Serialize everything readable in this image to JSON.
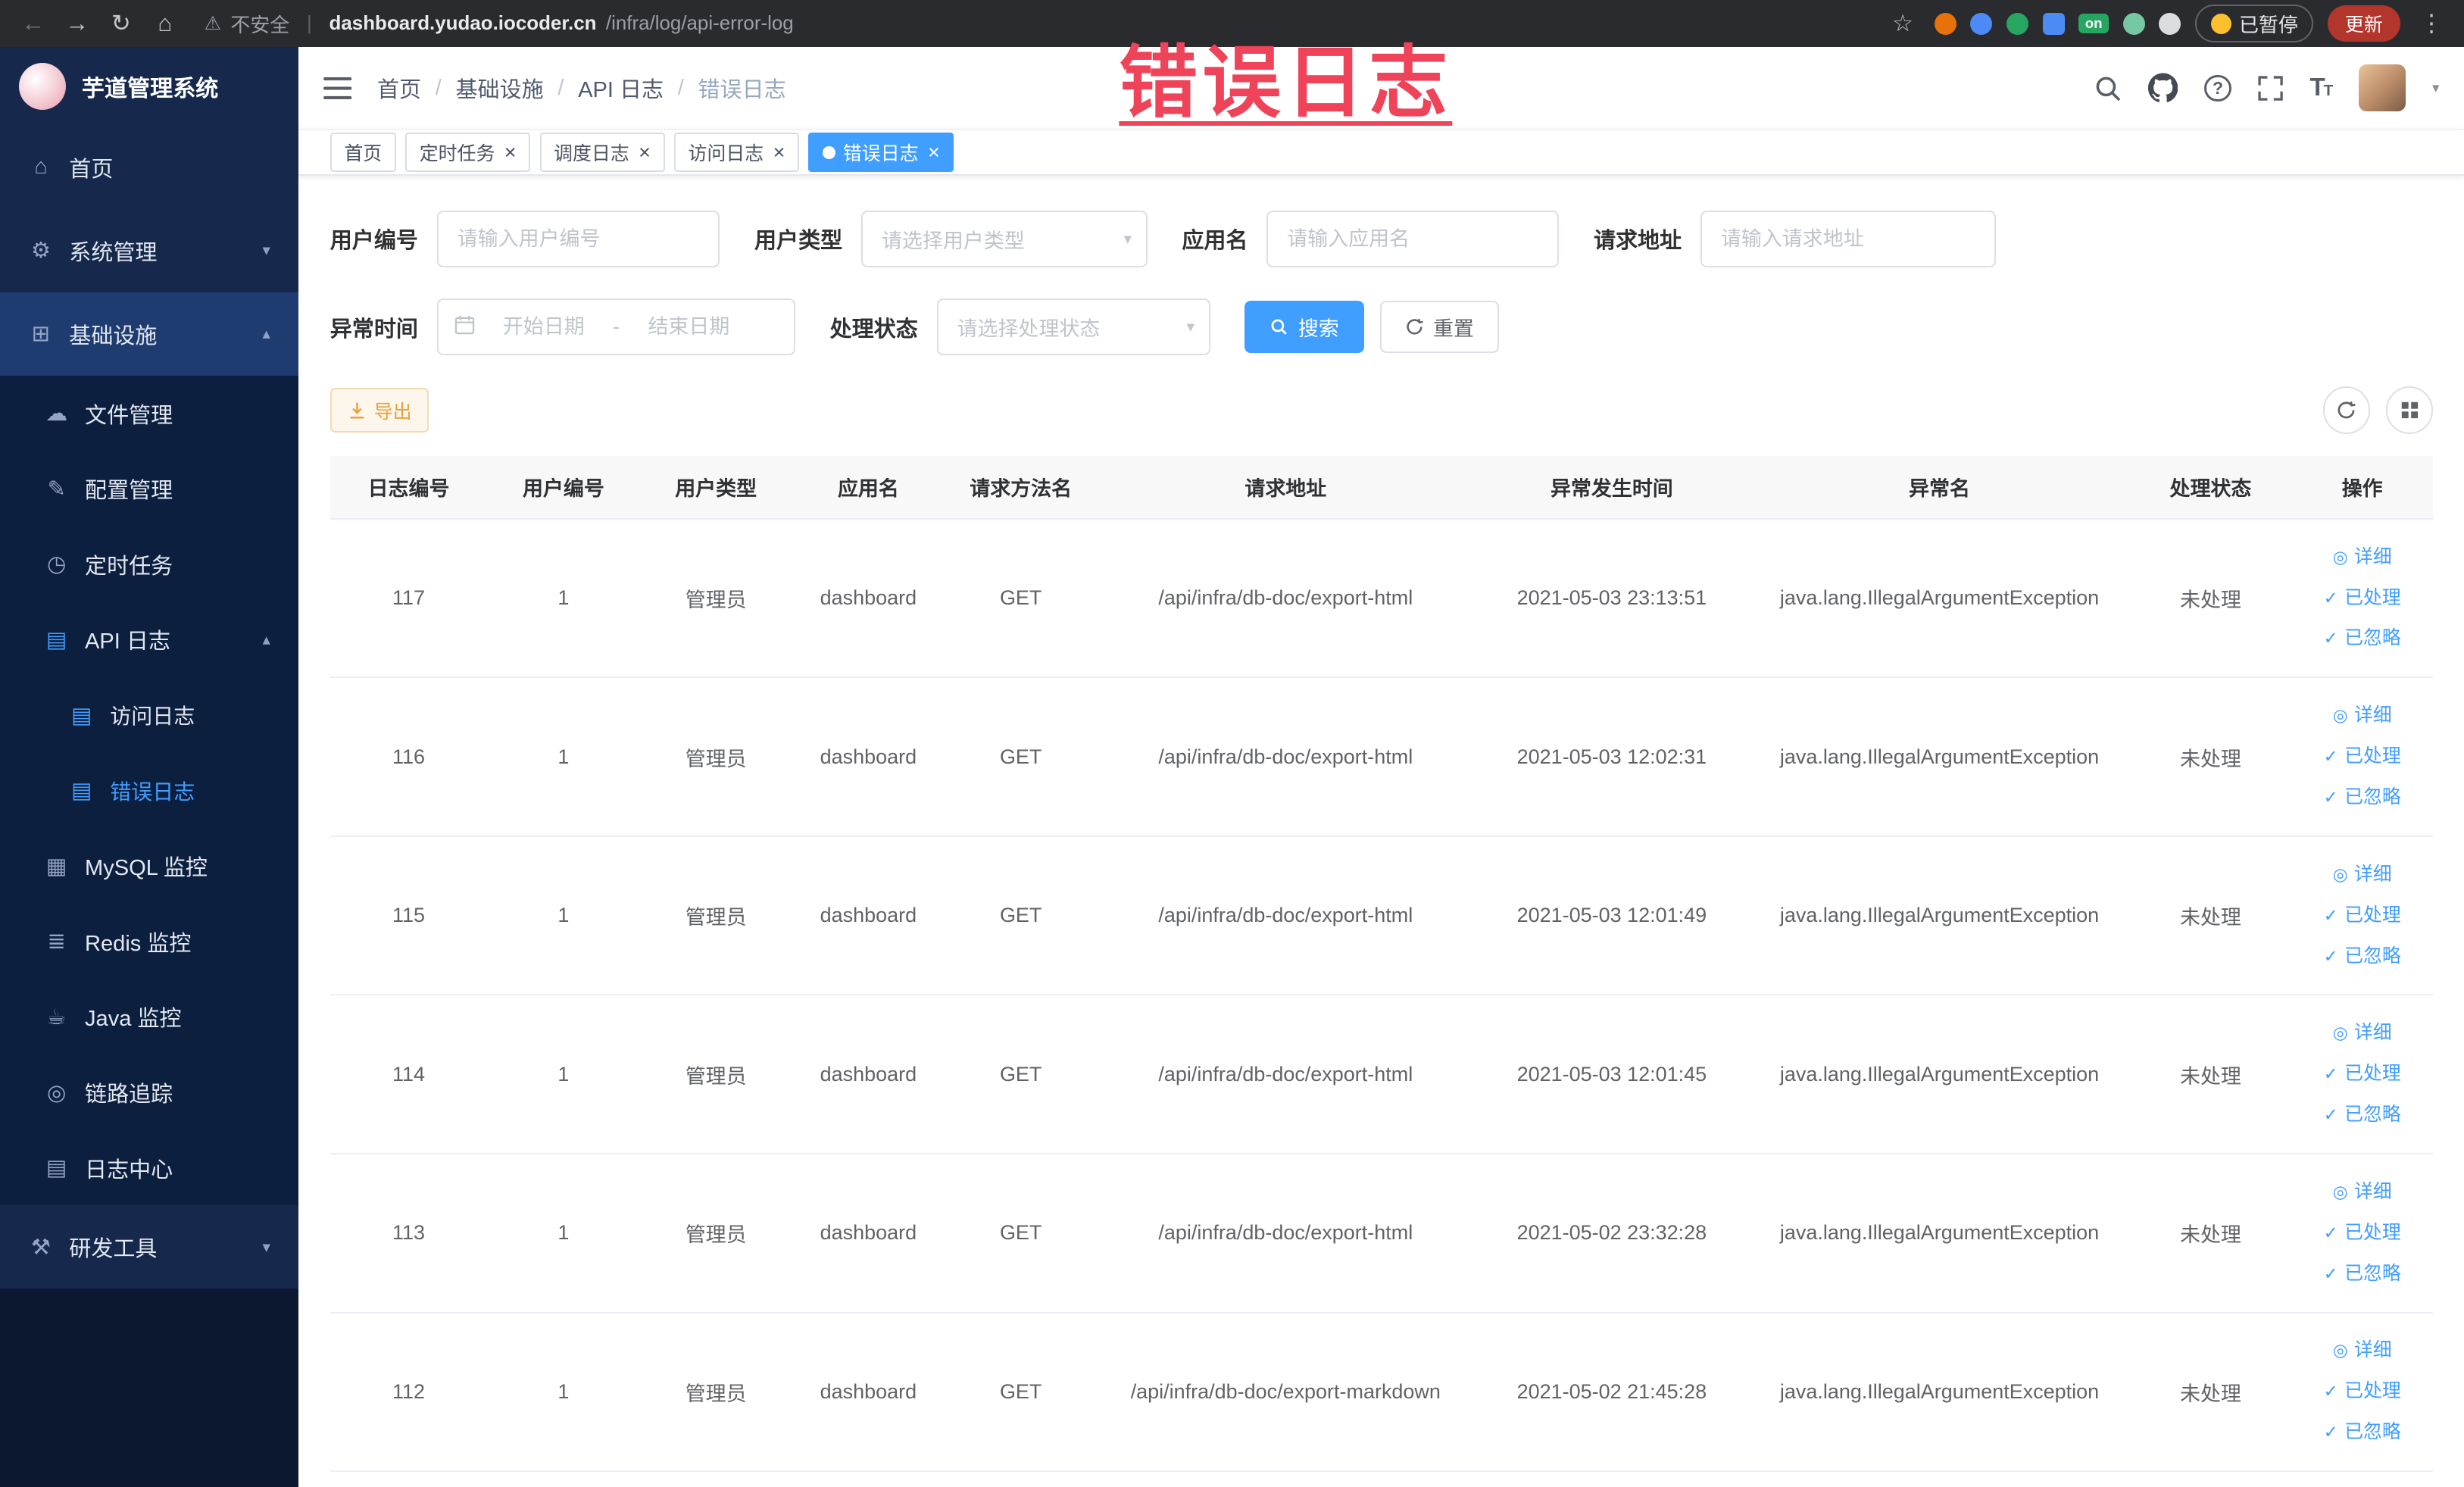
{
  "colors": {
    "accent": "#409eff",
    "warning": "#e6a23c",
    "annotation_red": "#ee4358",
    "sidebar_bg": "#16294c",
    "sidebar_submenu_bg": "#0d1f3e",
    "tab_active_bg": "#409eff"
  },
  "browser": {
    "security_label": "不安全",
    "url_host": "dashboard.yudao.iocoder.cn",
    "url_path": "/infra/log/api-error-log",
    "on_badge": "on",
    "paused_badge": "已暂停",
    "update_button": "更新"
  },
  "annotation": {
    "text": "错误日志"
  },
  "icons": {
    "back": "←",
    "forward": "→",
    "reload": "↻",
    "home_browser": "⌂",
    "warning": "⚠",
    "star": "☆",
    "menu_dots": "⋮",
    "url_separator": "|",
    "home": "⌂",
    "system": "⚙",
    "infra": "⊞",
    "file": "☁",
    "config": "✎",
    "job": "◷",
    "api_log": "▤",
    "access_log": "▤",
    "error_log": "▤",
    "mysql": "▦",
    "redis": "≣",
    "java": "☕",
    "trace": "◎",
    "log_center": "▤",
    "dev_tools": "⚒",
    "chevron_down": "▾",
    "chevron_up": "▴",
    "caret_down": "▾",
    "eye": "◎",
    "check": "✓",
    "close": "×"
  },
  "sidebar": {
    "logo_title": "芋道管理系统",
    "home": "首页",
    "system": "系统管理",
    "infra": "基础设施",
    "file": "文件管理",
    "config": "配置管理",
    "job": "定时任务",
    "api_log": "API 日志",
    "access_log": "访问日志",
    "error_log": "错误日志",
    "mysql": "MySQL 监控",
    "redis": "Redis 监控",
    "java": "Java 监控",
    "trace": "链路追踪",
    "log_center": "日志中心",
    "dev_tools": "研发工具"
  },
  "breadcrumb": [
    "首页",
    "基础设施",
    "API 日志",
    "错误日志"
  ],
  "tabs": [
    {
      "label": "首页",
      "active": false,
      "closable": false
    },
    {
      "label": "定时任务",
      "active": false,
      "closable": true
    },
    {
      "label": "调度日志",
      "active": false,
      "closable": true
    },
    {
      "label": "访问日志",
      "active": false,
      "closable": true
    },
    {
      "label": "错误日志",
      "active": true,
      "closable": true
    }
  ],
  "filters": {
    "user_id_label": "用户编号",
    "user_id_placeholder": "请输入用户编号",
    "user_type_label": "用户类型",
    "user_type_placeholder": "请选择用户类型",
    "app_name_label": "应用名",
    "app_name_placeholder": "请输入应用名",
    "request_url_label": "请求地址",
    "request_url_placeholder": "请输入请求地址",
    "exception_time_label": "异常时间",
    "date_start_placeholder": "开始日期",
    "date_separator": "-",
    "date_end_placeholder": "结束日期",
    "process_status_label": "处理状态",
    "process_status_placeholder": "请选择处理状态",
    "search_button": "搜索",
    "reset_button": "重置"
  },
  "toolbar": {
    "export_button": "导出"
  },
  "table": {
    "columns": [
      "日志编号",
      "用户编号",
      "用户类型",
      "应用名",
      "请求方法名",
      "请求地址",
      "异常发生时间",
      "异常名",
      "处理状态",
      "操作"
    ],
    "action_labels": {
      "detail": "详细",
      "processed": "已处理",
      "ignored": "已忽略"
    },
    "rows": [
      {
        "id": "117",
        "user_id": "1",
        "user_type": "管理员",
        "app": "dashboard",
        "method": "GET",
        "url": "/api/infra/db-doc/export-html",
        "time": "2021-05-03 23:13:51",
        "exception": "java.lang.IllegalArgumentException",
        "status": "未处理"
      },
      {
        "id": "116",
        "user_id": "1",
        "user_type": "管理员",
        "app": "dashboard",
        "method": "GET",
        "url": "/api/infra/db-doc/export-html",
        "time": "2021-05-03 12:02:31",
        "exception": "java.lang.IllegalArgumentException",
        "status": "未处理"
      },
      {
        "id": "115",
        "user_id": "1",
        "user_type": "管理员",
        "app": "dashboard",
        "method": "GET",
        "url": "/api/infra/db-doc/export-html",
        "time": "2021-05-03 12:01:49",
        "exception": "java.lang.IllegalArgumentException",
        "status": "未处理"
      },
      {
        "id": "114",
        "user_id": "1",
        "user_type": "管理员",
        "app": "dashboard",
        "method": "GET",
        "url": "/api/infra/db-doc/export-html",
        "time": "2021-05-03 12:01:45",
        "exception": "java.lang.IllegalArgumentException",
        "status": "未处理"
      },
      {
        "id": "113",
        "user_id": "1",
        "user_type": "管理员",
        "app": "dashboard",
        "method": "GET",
        "url": "/api/infra/db-doc/export-html",
        "time": "2021-05-02 23:32:28",
        "exception": "java.lang.IllegalArgumentException",
        "status": "未处理"
      },
      {
        "id": "112",
        "user_id": "1",
        "user_type": "管理员",
        "app": "dashboard",
        "method": "GET",
        "url": "/api/infra/db-doc/export-markdown",
        "time": "2021-05-02 21:45:28",
        "exception": "java.lang.IllegalArgumentException",
        "status": "未处理"
      }
    ]
  }
}
